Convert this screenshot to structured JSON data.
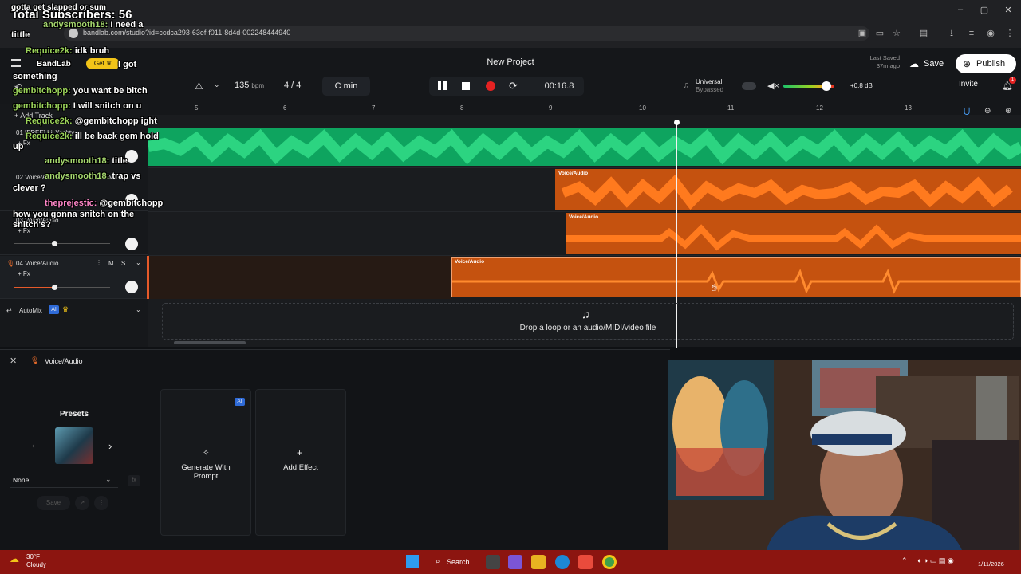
{
  "stream": {
    "subscribers": "Total Subscribers: 56",
    "chat": [
      {
        "user": "",
        "text": "gotta get slapped or sum"
      },
      {
        "user": "andysmooth18:",
        "text": "I need a"
      },
      {
        "user": "",
        "text": "tittle"
      },
      {
        "user": "",
        "text": "BandLab"
      },
      {
        "user": "",
        "text": "I got"
      },
      {
        "user": "",
        "text": "something"
      },
      {
        "user": "Requice2k:",
        "text": "idk bruh"
      },
      {
        "user": "gembitchopp:",
        "text": "you want be bitch"
      },
      {
        "user": "gembitchopp:",
        "text": "I will snitch on u"
      },
      {
        "user": "Requice2k:",
        "text": "@gembitchopp ight"
      },
      {
        "user": "Requice2k:",
        "text": "ill be back gem hold"
      },
      {
        "user": "",
        "text": "up"
      },
      {
        "user": "andysmooth18:",
        "text": "title"
      },
      {
        "user": "andysmooth18:",
        "text": "trap vs"
      },
      {
        "user": "",
        "text": "clever ?"
      },
      {
        "user": "theprejestic:",
        "text": "@gembitchopp"
      },
      {
        "user": "",
        "text": "how you gonna snitch on the"
      },
      {
        "user": "",
        "text": "snitch's?"
      }
    ]
  },
  "browser": {
    "url": "bandlab.com/studio?id=ccdca293-63ef-f011-8d4d-002248444940"
  },
  "header": {
    "project_title": "New Project",
    "last_saved_label": "Last Saved",
    "last_saved_time": "37m ago",
    "save_label": "Save",
    "publish_label": "Publish",
    "invite_label": "Invite",
    "notification_count": "1",
    "get_label": "Get"
  },
  "toolbar": {
    "bpm_value": "135",
    "bpm_unit": "bpm",
    "time_signature": "4 / 4",
    "key": "C min",
    "time": "00:16.8",
    "universal_label": "Universal",
    "bypassed_label": "Bypassed",
    "volume_db": "+0.8 dB",
    "volume_level": 0.85
  },
  "ruler": {
    "bars": [
      "5",
      "6",
      "7",
      "8",
      "9",
      "10",
      "11",
      "12",
      "13"
    ]
  },
  "tracks": {
    "add_track_label": "Add Track",
    "list": [
      {
        "number": "01",
        "name": "[FREE] Lil Yachty",
        "fx": "+ Fx"
      },
      {
        "number": "02",
        "name": "Voice/Audio",
        "fx": "+ Fx"
      },
      {
        "number": "03",
        "name": "Voice/Audio",
        "fx": "+ Fx"
      },
      {
        "number": "04",
        "name": "Voice/Audio",
        "fx": "+ Fx"
      }
    ],
    "mute_label": "M",
    "solo_label": "S",
    "automix_label": "AutoMix",
    "ai_badge": "AI"
  },
  "clips": {
    "voice_label": "Voice/Audio"
  },
  "timeline": {
    "drop_text": "Drop a loop or an audio/MIDI/video file"
  },
  "fx_panel": {
    "track_name": "Voice/Audio",
    "presets_label": "Presets",
    "preset_value": "None",
    "save_label": "Save",
    "ai_badge": "AI",
    "generate_label": "Generate With Prompt",
    "add_effect_label": "Add Effect"
  },
  "taskbar": {
    "temperature": "30°F",
    "condition": "Cloudy",
    "search_label": "Search",
    "date": "1/11/2026"
  },
  "colors": {
    "green_clip": "#0ea45f",
    "orange_clip": "#c5520f",
    "record": "#e52222",
    "taskbar": "#8c1510"
  }
}
